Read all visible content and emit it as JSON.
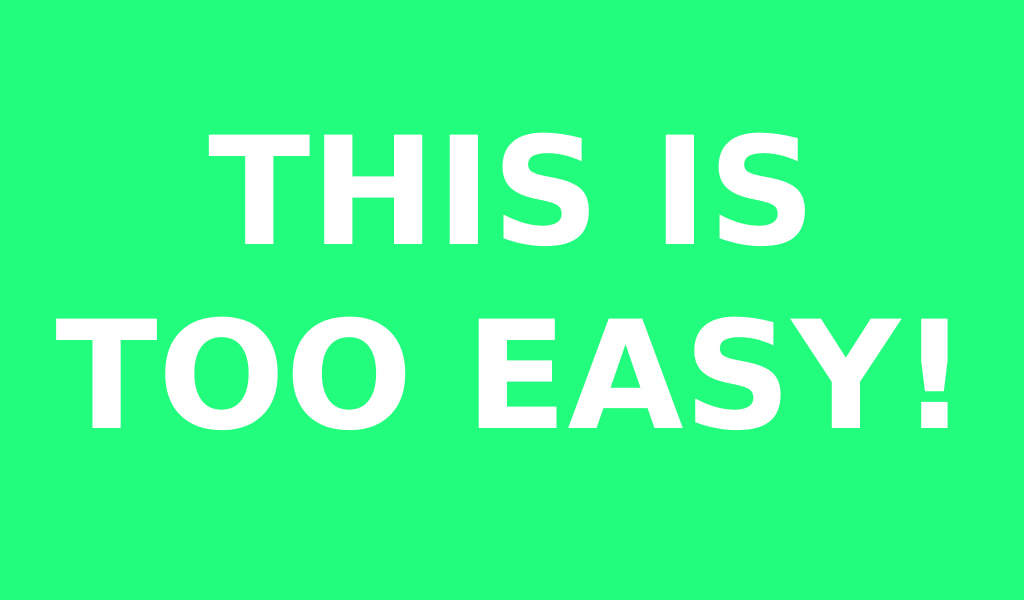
{
  "screen": {
    "background_color": "#23fd7d",
    "text_color": "#ffffff",
    "lines": [
      "THIS IS",
      "TOO EASY!"
    ]
  }
}
